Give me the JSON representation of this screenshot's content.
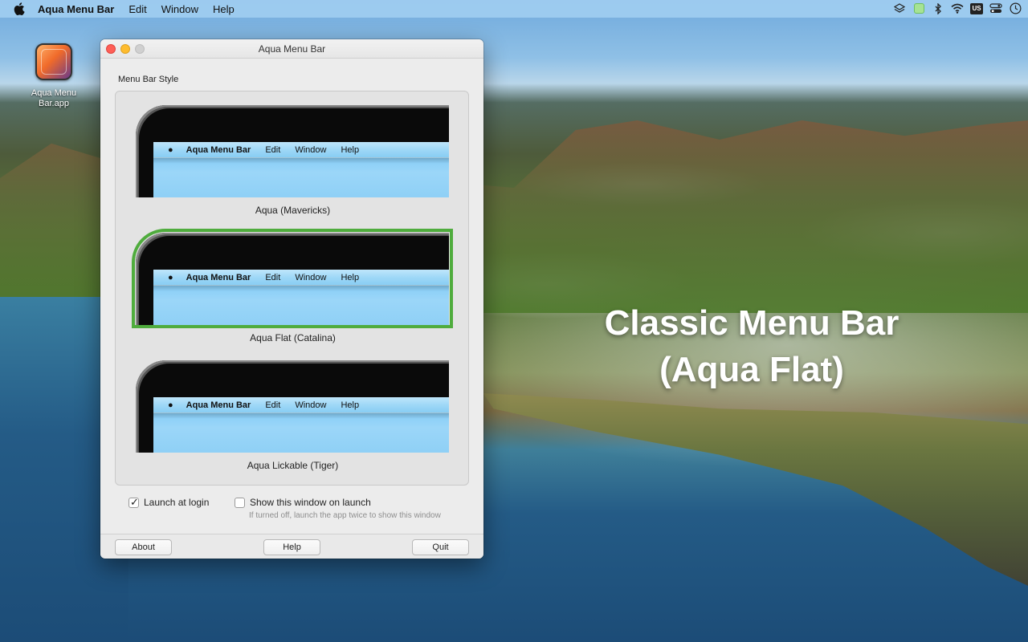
{
  "menubar": {
    "apple_icon": "apple-icon",
    "app_name": "Aqua Menu Bar",
    "items": [
      "Edit",
      "Window",
      "Help"
    ],
    "status_icons": [
      "layers-icon",
      "green-square-icon",
      "bluetooth-icon",
      "wifi-icon",
      "input-source-icon",
      "control-center-icon",
      "clock-icon"
    ],
    "input_source": "US"
  },
  "desktop": {
    "icon_label": "Aqua Menu Bar.app",
    "overlay_line1": "Classic Menu Bar",
    "overlay_line2": "(Aqua Flat)"
  },
  "window": {
    "title": "Aqua Menu Bar",
    "section_label": "Menu Bar Style",
    "preview_menu": {
      "app_name": "Aqua Menu Bar",
      "items": [
        "Edit",
        "Window",
        "Help"
      ]
    },
    "styles": [
      {
        "label": "Aqua (Mavericks)",
        "selected": false
      },
      {
        "label": "Aqua Flat (Catalina)",
        "selected": true
      },
      {
        "label": "Aqua Lickable (Tiger)",
        "selected": false
      }
    ],
    "launch_at_login": {
      "label": "Launch at login",
      "checked": true
    },
    "show_window": {
      "label": "Show this window on launch",
      "checked": false
    },
    "hint": "If turned off, launch the app twice to show this window",
    "buttons": {
      "about": "About",
      "help": "Help",
      "quit": "Quit"
    }
  },
  "colors": {
    "selection_border": "#4fac3d",
    "close": "#fe5f57",
    "minimize": "#febc2e"
  }
}
